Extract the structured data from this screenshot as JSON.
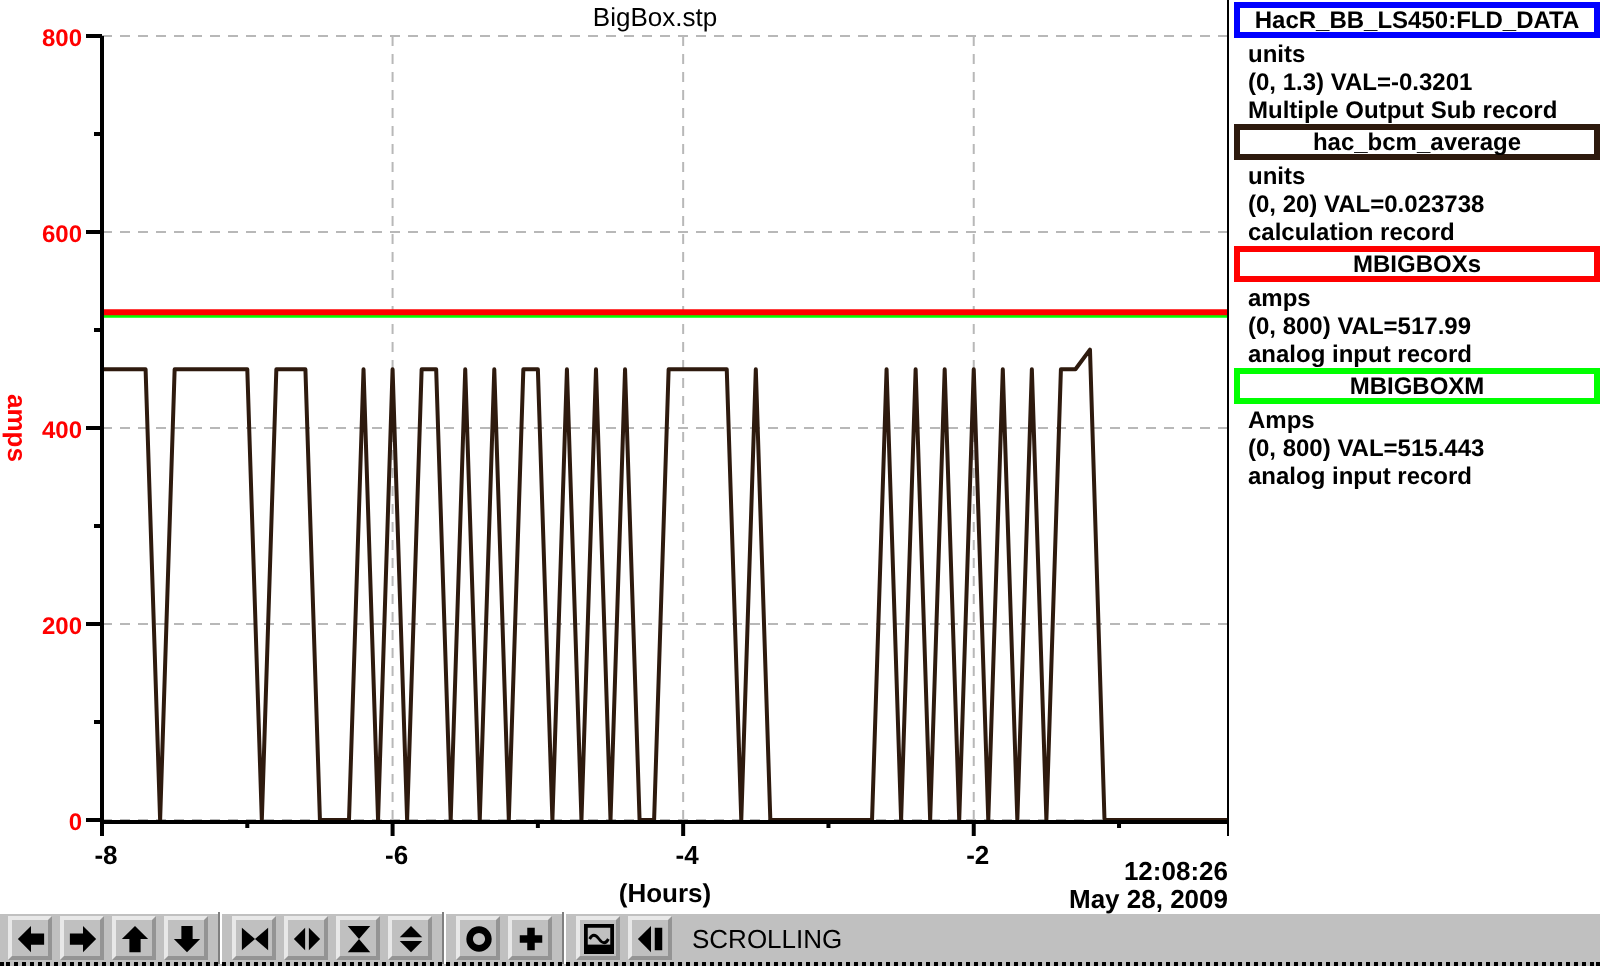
{
  "chart": {
    "chart_data": {
      "type": "line",
      "title": "BigBox.stp",
      "xlabel": "(Hours)",
      "ylabel": "amps",
      "x": [
        -8.0,
        -7.9,
        -7.8,
        -7.7,
        -7.6,
        -7.5,
        -7.4,
        -7.3,
        -7.2,
        -7.1,
        -7.0,
        -6.9,
        -6.8,
        -6.7,
        -6.6,
        -6.5,
        -6.4,
        -6.3,
        -6.2,
        -6.1,
        -6.0,
        -5.9,
        -5.8,
        -5.7,
        -5.6,
        -5.5,
        -5.4,
        -5.3,
        -5.2,
        -5.1,
        -5.0,
        -4.9,
        -4.8,
        -4.7,
        -4.6,
        -4.5,
        -4.4,
        -4.3,
        -4.2,
        -4.1,
        -4.0,
        -3.9,
        -3.8,
        -3.7,
        -3.6,
        -3.5,
        -3.4,
        -3.3,
        -3.2,
        -3.1,
        -3.0,
        -2.9,
        -2.8,
        -2.7,
        -2.6,
        -2.5,
        -2.4,
        -2.3,
        -2.2,
        -2.1,
        -2.0,
        -1.9,
        -1.8,
        -1.7,
        -1.6,
        -1.5,
        -1.4,
        -1.3,
        -1.2,
        -1.1,
        -1.0,
        -0.9,
        -0.8,
        -0.7,
        -0.6,
        -0.5,
        -0.4,
        -0.25
      ],
      "series": [
        {
          "color": "#00ff00",
          "values": [
            515.443,
            515.443,
            515.443,
            515.443,
            515.443,
            515.443,
            515.443,
            515.443,
            515.443,
            515.443,
            515.443,
            515.443,
            515.443,
            515.443,
            515.443,
            515.443,
            515.443,
            515.443,
            515.443,
            515.443,
            515.443,
            515.443,
            515.443,
            515.443,
            515.443,
            515.443,
            515.443,
            515.443,
            515.443,
            515.443,
            515.443,
            515.443,
            515.443,
            515.443,
            515.443,
            515.443,
            515.443,
            515.443,
            515.443,
            515.443,
            515.443,
            515.443,
            515.443,
            515.443,
            515.443,
            515.443,
            515.443,
            515.443,
            515.443,
            515.443,
            515.443,
            515.443,
            515.443,
            515.443,
            515.443,
            515.443,
            515.443,
            515.443,
            515.443,
            515.443,
            515.443,
            515.443,
            515.443,
            515.443,
            515.443,
            515.443,
            515.443,
            515.443,
            515.443,
            515.443,
            515.443,
            515.443,
            515.443,
            515.443,
            515.443,
            515.443,
            515.443,
            515.443
          ]
        },
        {
          "color": "#ff0000",
          "values": [
            517.99,
            517.99,
            517.99,
            517.99,
            517.99,
            517.99,
            517.99,
            517.99,
            517.99,
            517.99,
            517.99,
            517.99,
            517.99,
            517.99,
            517.99,
            517.99,
            517.99,
            517.99,
            517.99,
            517.99,
            517.99,
            517.99,
            517.99,
            517.99,
            517.99,
            517.99,
            517.99,
            517.99,
            517.99,
            517.99,
            517.99,
            517.99,
            517.99,
            517.99,
            517.99,
            517.99,
            517.99,
            517.99,
            517.99,
            517.99,
            517.99,
            517.99,
            517.99,
            517.99,
            517.99,
            517.99,
            517.99,
            517.99,
            517.99,
            517.99,
            517.99,
            517.99,
            517.99,
            517.99,
            517.99,
            517.99,
            517.99,
            517.99,
            517.99,
            517.99,
            517.99,
            517.99,
            517.99,
            517.99,
            517.99,
            517.99,
            517.99,
            517.99,
            517.99,
            517.99,
            517.99,
            517.99,
            517.99,
            517.99,
            517.99,
            517.99,
            517.99,
            517.99
          ]
        },
        {
          "color": "#2e1a0e",
          "values": [
            460,
            460,
            460,
            460,
            0,
            460,
            460,
            460,
            460,
            460,
            460,
            0,
            460,
            460,
            460,
            0,
            0,
            0,
            460,
            0,
            460,
            0,
            460,
            460,
            0,
            460,
            0,
            460,
            0,
            460,
            460,
            0,
            460,
            0,
            460,
            0,
            460,
            0,
            0,
            460,
            460,
            460,
            460,
            460,
            0,
            460,
            0,
            0,
            0,
            0,
            0,
            0,
            0,
            0,
            460,
            0,
            460,
            0,
            460,
            0,
            460,
            0,
            460,
            0,
            460,
            0,
            460,
            460,
            480,
            0,
            0,
            0,
            0,
            0,
            0,
            0,
            0,
            0
          ]
        }
      ],
      "grid": true,
      "xlim": [
        -8,
        -0.25
      ],
      "ylim": [
        0,
        800
      ],
      "xticks": [
        -8,
        -6,
        -4,
        -2
      ],
      "yticks": [
        0,
        200,
        400,
        600,
        800
      ]
    },
    "timestamp_time": "12:08:26",
    "timestamp_date": "May 28, 2009"
  },
  "legend": [
    {
      "name": "HacR_BB_LS450:FLD_DATA",
      "color": "#0000ff",
      "units": "units",
      "range_value": "(0, 1.3) VAL=-0.3201",
      "record_type": "Multiple Output Sub record"
    },
    {
      "name": "hac_bcm_average",
      "color": "#2e1a0e",
      "units": "units",
      "range_value": "(0, 20) VAL=0.023738",
      "record_type": "calculation record"
    },
    {
      "name": "MBIGBOXs",
      "color": "#ff0000",
      "units": "amps",
      "range_value": "(0, 800) VAL=517.99",
      "record_type": "analog input record"
    },
    {
      "name": "MBIGBOXM",
      "color": "#00ff00",
      "units": "Amps",
      "range_value": "(0, 800) VAL=515.443",
      "record_type": "analog input record"
    }
  ],
  "toolbar": {
    "status": "SCROLLING"
  }
}
